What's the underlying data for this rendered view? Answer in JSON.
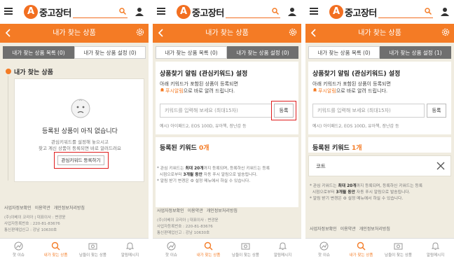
{
  "app": {
    "logo_letter": "A",
    "logo_text": "중고장터",
    "page_title": "내가 찾는 상품"
  },
  "colors": {
    "accent": "#f47b25",
    "highlight_border": "#e01d1d",
    "background": "#f0ece0"
  },
  "tabs": {
    "list_label": "내가 찾는 상품 목록 (0)",
    "settings_label_0": "내가 찾는 상품 설정 (0)",
    "settings_label_1": "내가 찾는 상품 설정 (1)",
    "list_label_p3": "내가 찾는 상품 목록 (0)"
  },
  "panel1": {
    "section_title": "내가 찾는 상품",
    "empty_title": "등록된 상품이 아직 없습니다",
    "empty_sub1": "관심키워드를 설정해 놓으시고",
    "empty_sub2": "찾고 계신 상품이 등록되면 바로 알려드려요",
    "register_button": "관심키워드 등록하기"
  },
  "settings": {
    "title": "상품찾기 알림 (관심키워드) 설정",
    "desc1": "아래 키워드가 포함된 상품이 등록되면",
    "desc2_highlight": "푸시알림",
    "desc2_rest": "으로 바로 알려 드립니다.",
    "input_placeholder": "키워드를 입력해 보세요 (최대15자)",
    "register_label": "등록",
    "example": "예시) 아이패드2, EOS 100D, 유아책, 장난감 등",
    "registered_title": "등록된 키워드",
    "count_p2": "0개",
    "count_p3": "1개",
    "keyword_item": "코트",
    "note1_prefix": "* 관심 키워드는 ",
    "note1_bold1": "최대 20개",
    "note1_mid": "까지 등록되며, 등록하신 키워드는 등록",
    "note2_prefix": "시점으로부터 ",
    "note2_bold": "3개월 동안",
    "note2_rest": " 자동 푸시 알림으로 발송됩니다.",
    "note3": "* 알림 받기 변경은 ⚙ 설정 메뉴에서 하실 수 있습니다."
  },
  "footer": {
    "link1": "사업자정보확인",
    "link2": "이용약관",
    "link3": "개인정보처리방침",
    "info1": "(주)이베이 코리아  |  대표이사 : 변광윤",
    "info2": "사업자등록번호 : 220-81-83676",
    "info3": "통신판매업신고 : 강남 10630호"
  },
  "nav": {
    "item1": "핫 이슈",
    "item2": "내가 찾는 상품",
    "item3": "남들이 찾는 상품",
    "item4": "알림메시지"
  }
}
